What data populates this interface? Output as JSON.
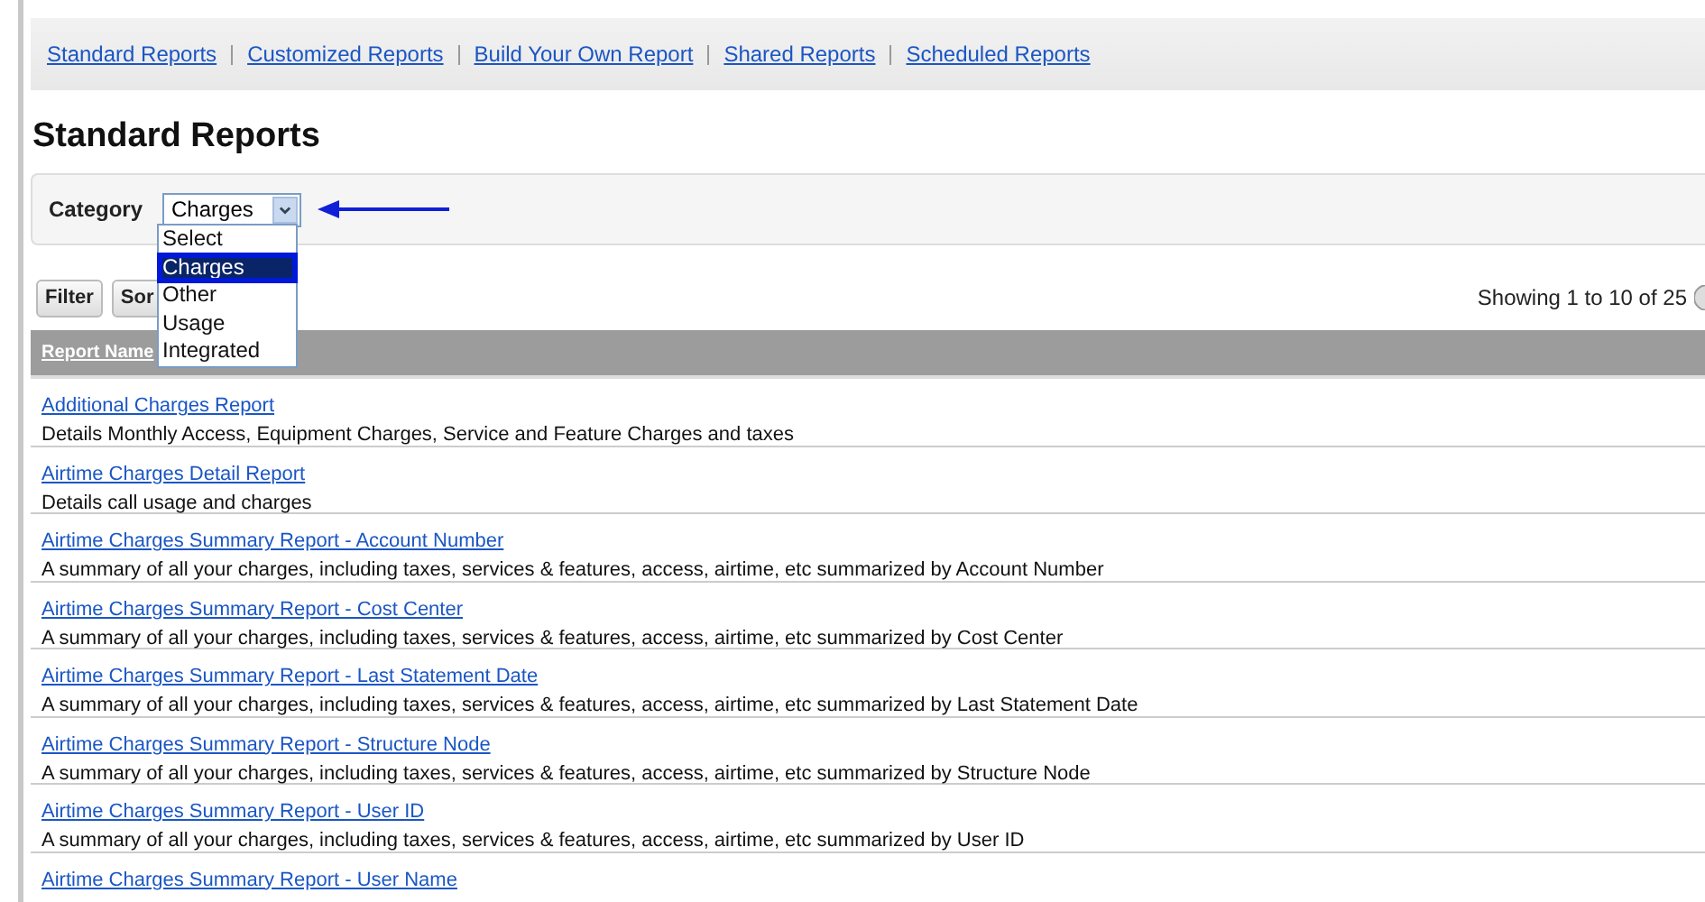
{
  "nav_links": [
    {
      "label": "Standard Reports"
    },
    {
      "label": "Customized Reports"
    },
    {
      "label": "Build Your Own Report"
    },
    {
      "label": "Shared Reports"
    },
    {
      "label": "Scheduled Reports"
    }
  ],
  "title": "Standard Reports",
  "category": {
    "label": "Category",
    "value": "Charges",
    "options": [
      {
        "label": "Select",
        "selected": false
      },
      {
        "label": "Charges",
        "selected": true
      },
      {
        "label": "Other",
        "selected": false
      },
      {
        "label": "Usage",
        "selected": false
      },
      {
        "label": "Integrated",
        "selected": false
      }
    ]
  },
  "toolbar": {
    "buttons": [
      "Filter",
      "Sor"
    ],
    "showing": "Showing 1 to 10 of 25"
  },
  "table": {
    "columns": [
      "Report Name"
    ],
    "rows": [
      {
        "name": "Additional Charges Report",
        "description": "Details Monthly Access, Equipment Charges, Service and Feature Charges and taxes"
      },
      {
        "name": "Airtime Charges Detail Report",
        "description": "Details call usage and charges"
      },
      {
        "name": "Airtime Charges Summary Report - Account Number",
        "description": "A summary of all your charges, including taxes, services & features, access, airtime, etc summarized by Account Number"
      },
      {
        "name": "Airtime Charges Summary Report - Cost Center",
        "description": "A summary of all your charges, including taxes, services & features, access, airtime, etc summarized by Cost Center"
      },
      {
        "name": "Airtime Charges Summary Report - Last Statement Date",
        "description": "A summary of all your charges, including taxes, services & features, access, airtime, etc summarized by Last Statement Date"
      },
      {
        "name": "Airtime Charges Summary Report - Structure Node",
        "description": "A summary of all your charges, including taxes, services & features, access, airtime, etc summarized by Structure Node"
      },
      {
        "name": "Airtime Charges Summary Report - User ID",
        "description": "A summary of all your charges, including taxes, services & features, access, airtime, etc summarized by User ID"
      },
      {
        "name": "Airtime Charges Summary Report - User Name"
      }
    ]
  }
}
